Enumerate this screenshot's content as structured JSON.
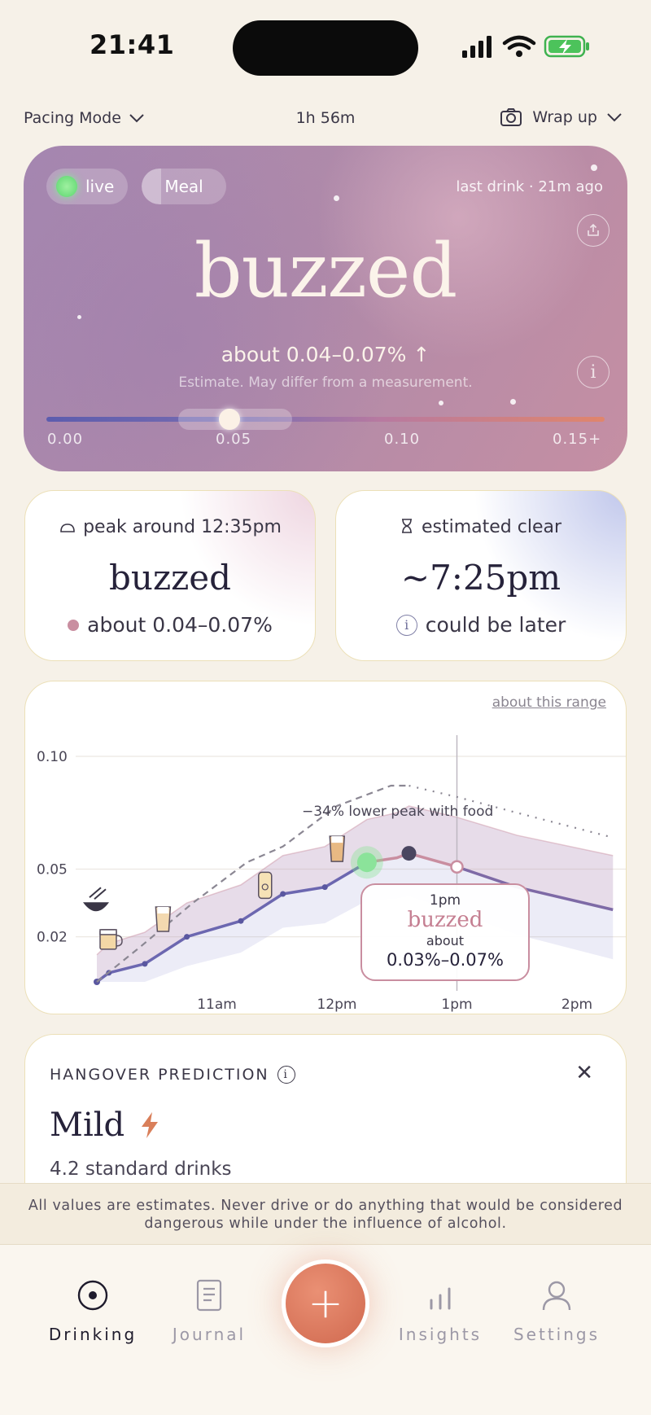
{
  "status_bar": {
    "time": "21:41"
  },
  "topbar": {
    "mode": "Pacing Mode",
    "duration": "1h 56m",
    "wrap_label": "Wrap up"
  },
  "hero": {
    "live_label": "live",
    "meal_label": "Meal",
    "last_drink": "last drink · 21m ago",
    "state": "buzzed",
    "range": "about 0.04–0.07% ↑",
    "note": "Estimate. May differ from a measurement.",
    "scale": [
      "0.00",
      "0.05",
      "0.10",
      "0.15+"
    ],
    "scale_value": 0.05
  },
  "peak_card": {
    "header": "peak around 12:35pm",
    "state": "buzzed",
    "range": "about 0.04–0.07%"
  },
  "clear_card": {
    "header": "estimated clear",
    "time": "~7:25pm",
    "note": "could be later"
  },
  "chart_card": {
    "about_link": "about this range",
    "tooltip": {
      "time": "1pm",
      "state": "buzzed",
      "prefix": "about",
      "range": "0.03%–0.07%"
    },
    "annotation": "−34% lower peak with food"
  },
  "chart_data": {
    "type": "line",
    "ylim": [
      0,
      0.105
    ],
    "yticks": [
      "0.10",
      "0.05",
      "0.02"
    ],
    "ytick_values": [
      0.1,
      0.05,
      0.02
    ],
    "xticks": [
      "11am",
      "12pm",
      "1pm",
      "2pm"
    ],
    "xtick_hours": [
      11,
      12,
      13,
      14
    ],
    "series": [
      {
        "name": "",
        "style": "solid",
        "color": "#7a6fb0",
        "x": [
          10.0,
          10.1,
          10.4,
          10.75,
          11.2,
          11.55,
          11.9,
          12.25,
          12.5,
          12.6,
          13.0,
          13.5,
          14.3
        ],
        "y": [
          0.0,
          0.004,
          0.008,
          0.02,
          0.027,
          0.039,
          0.042,
          0.053,
          0.055,
          0.057,
          0.051,
          0.042,
          0.032
        ]
      },
      {
        "name": "",
        "style": "dashed",
        "color": "#8b8793",
        "x": [
          10.0,
          10.35,
          10.8,
          11.25,
          11.55,
          12.0,
          12.45,
          12.6
        ],
        "y": [
          0.0,
          0.015,
          0.035,
          0.053,
          0.06,
          0.078,
          0.087,
          0.087
        ]
      },
      {
        "name": "",
        "style": "dotted",
        "color": "#8b8793",
        "x": [
          12.6,
          13.0,
          13.5,
          14.3
        ],
        "y": [
          0.087,
          0.082,
          0.075,
          0.064
        ]
      }
    ],
    "markers": [
      {
        "x": 12.25,
        "y": 0.053,
        "kind": "now"
      },
      {
        "x": 12.6,
        "y": 0.057,
        "kind": "peak"
      },
      {
        "x": 13.0,
        "y": 0.051,
        "kind": "cursor"
      }
    ],
    "drinks": [
      {
        "x": 10.0,
        "y": 0.017,
        "icon": "beer-mug-icon"
      },
      {
        "x": 10.45,
        "y": 0.026,
        "icon": "glass-icon"
      },
      {
        "x": 11.3,
        "y": 0.041,
        "icon": "can-icon"
      },
      {
        "x": 11.9,
        "y": 0.057,
        "icon": "cocktail-icon"
      }
    ],
    "meal": {
      "x": 10.0,
      "y": 0.036,
      "icon": "bowl-icon"
    }
  },
  "hangover": {
    "title": "HANGOVER PREDICTION",
    "level": "Mild",
    "drinks": "4.2 standard drinks"
  },
  "disclaimer": "All values are estimates. Never drive or do anything that would be considered dangerous while under the influence of alcohol.",
  "nav": {
    "drinking": "Drinking",
    "journal": "Journal",
    "add": "+",
    "insights": "Insights",
    "settings": "Settings"
  }
}
